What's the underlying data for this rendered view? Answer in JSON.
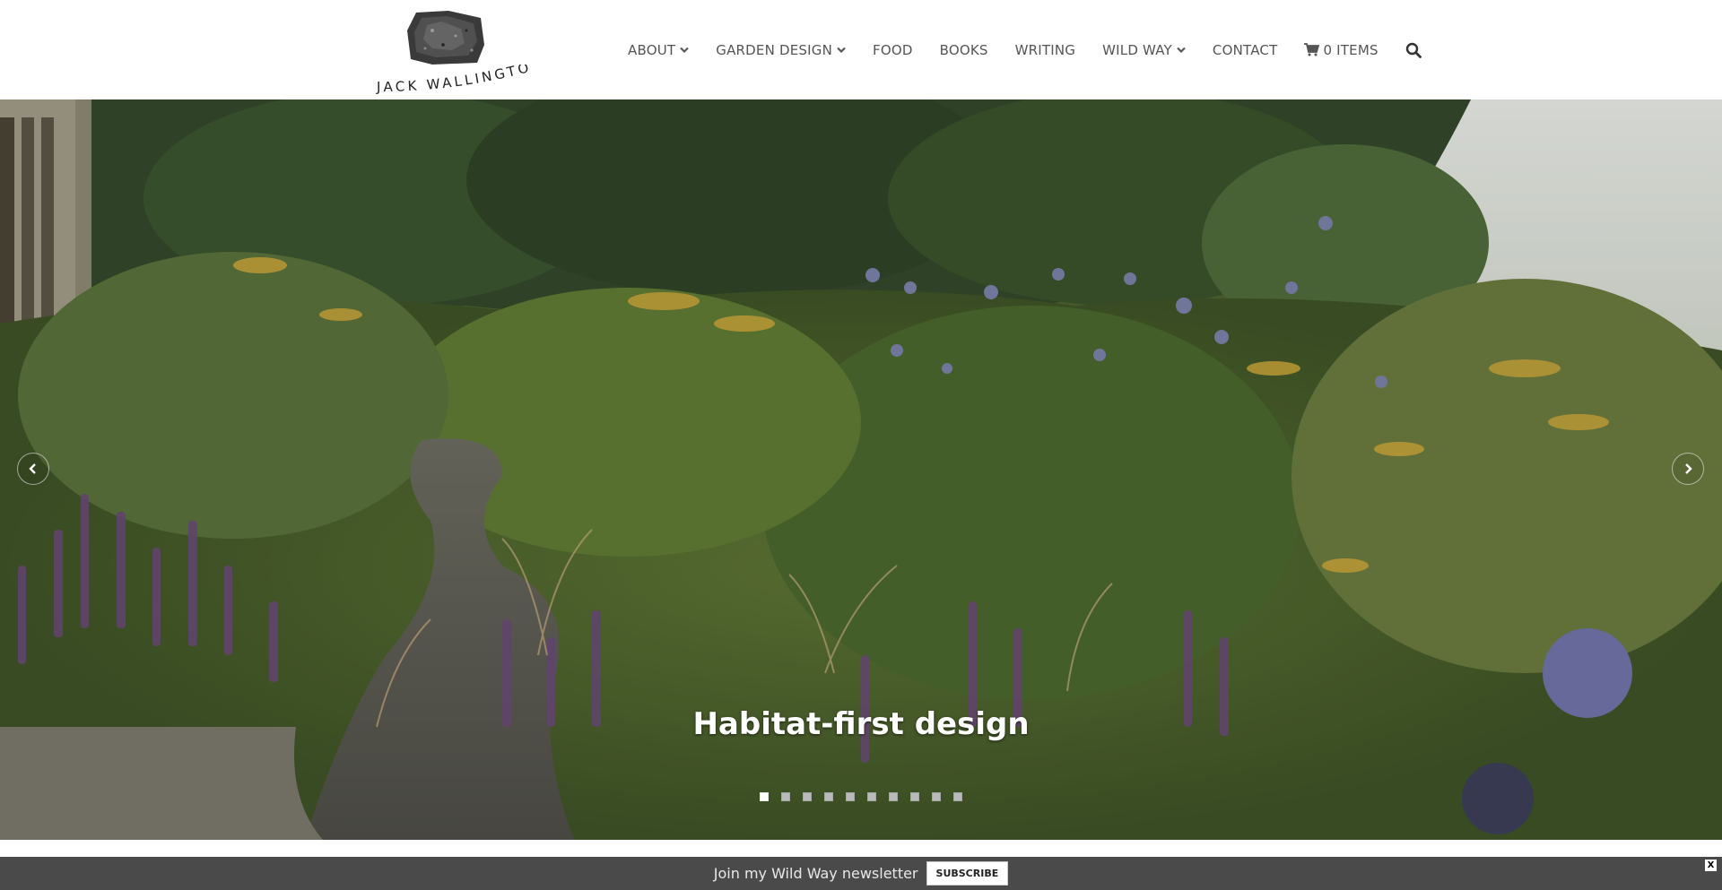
{
  "site": {
    "logo_text": "JACK WALLINGTON"
  },
  "nav": {
    "items": [
      {
        "label": "ABOUT",
        "has_dropdown": true
      },
      {
        "label": "GARDEN DESIGN",
        "has_dropdown": true
      },
      {
        "label": "FOOD",
        "has_dropdown": false
      },
      {
        "label": "BOOKS",
        "has_dropdown": false
      },
      {
        "label": "WRITING",
        "has_dropdown": false
      },
      {
        "label": "WILD WAY",
        "has_dropdown": true
      },
      {
        "label": "CONTACT",
        "has_dropdown": false
      }
    ],
    "cart_label": "0 ITEMS",
    "cart_icon": "cart-icon",
    "search_icon": "search-icon"
  },
  "hero": {
    "caption": "Habitat-first design",
    "slide_count": 10,
    "active_slide": 1,
    "prev_icon": "chevron-left-icon",
    "next_icon": "chevron-right-icon"
  },
  "newsletter": {
    "text": "Join my Wild Way newsletter",
    "button_label": "SUBSCRIBE",
    "close_label": "X"
  },
  "colors": {
    "nav_text": "#555555",
    "newsletter_bg": "#4a4a4a",
    "caption_text": "#ffffff"
  }
}
